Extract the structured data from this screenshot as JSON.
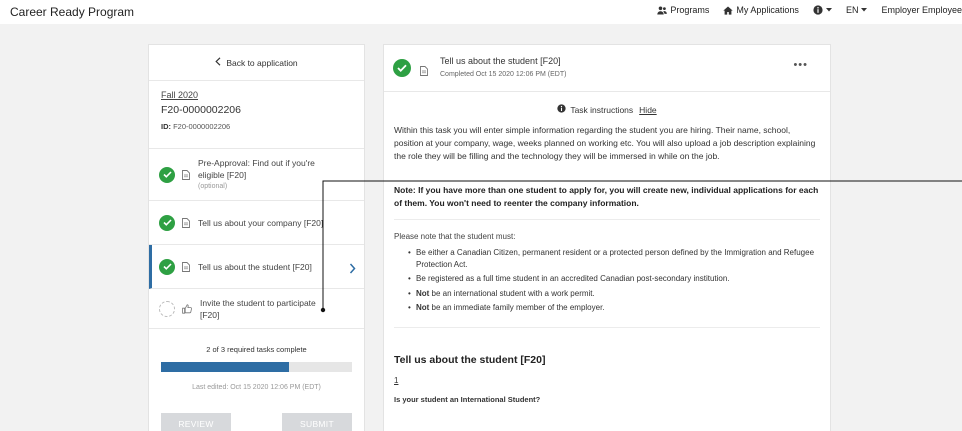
{
  "topbar": {
    "brand": "Career Ready Program",
    "programs": "Programs",
    "my_applications": "My Applications",
    "language": "EN",
    "user": "Employer Employee"
  },
  "left": {
    "back_label": "Back to application",
    "term": "Fall 2020",
    "app_number": "F20-0000002206",
    "id_label": "ID:",
    "id_value": "F20-0000002206",
    "tasks": [
      {
        "label": "Pre-Approval: Find out if you're eligible [F20]",
        "note": "(optional)",
        "status": "complete"
      },
      {
        "label": "Tell us about your company [F20]",
        "status": "complete"
      },
      {
        "label": "Tell us about the student [F20]",
        "status": "complete"
      },
      {
        "label": "Invite the student to participate [F20]",
        "status": "pending"
      }
    ],
    "progress_text": "2 of 3 required tasks complete",
    "progress_fraction": 0.67,
    "last_edited": "Last edited: Oct 15 2020 12:06 PM (EDT)",
    "review_label": "REVIEW",
    "submit_label": "SUBMIT"
  },
  "right": {
    "title": "Tell us about the student [F20]",
    "completed": "Completed Oct 15 2020 12:06 PM (EDT)",
    "more": "•••",
    "instructions_label": "Task instructions",
    "hide_label": "Hide",
    "paragraph": "Within this task you will enter simple information regarding the student you are hiring. Their name, school, position at your company, wage, weeks planned on working etc. You will also upload a job description explaining the role they will be filling and the technology they will be immersed in while on the job.",
    "note": "Note: If you have more than one student to apply for, you will create new, individual applications for each of them. You won't need to reenter the company information.",
    "must_intro": "Please note that the student must:",
    "requirements": [
      {
        "bold": "",
        "text": "Be either a Canadian Citizen, permanent resident or a protected person defined by the Immigration and Refugee Protection Act."
      },
      {
        "bold": "",
        "text": "Be registered as a full time student in an accredited Canadian post-secondary institution."
      },
      {
        "bold": "Not",
        "text": " be an international student with a work permit."
      },
      {
        "bold": "Not",
        "text": " be an immediate family member of the employer."
      }
    ],
    "section_title": "Tell us about the student [F20]",
    "question_number": "1",
    "question": "Is your student an International Student?"
  },
  "colors": {
    "accent": "#2e6da4",
    "success": "#2ea043",
    "disabled_button": "#d7d9dc"
  }
}
